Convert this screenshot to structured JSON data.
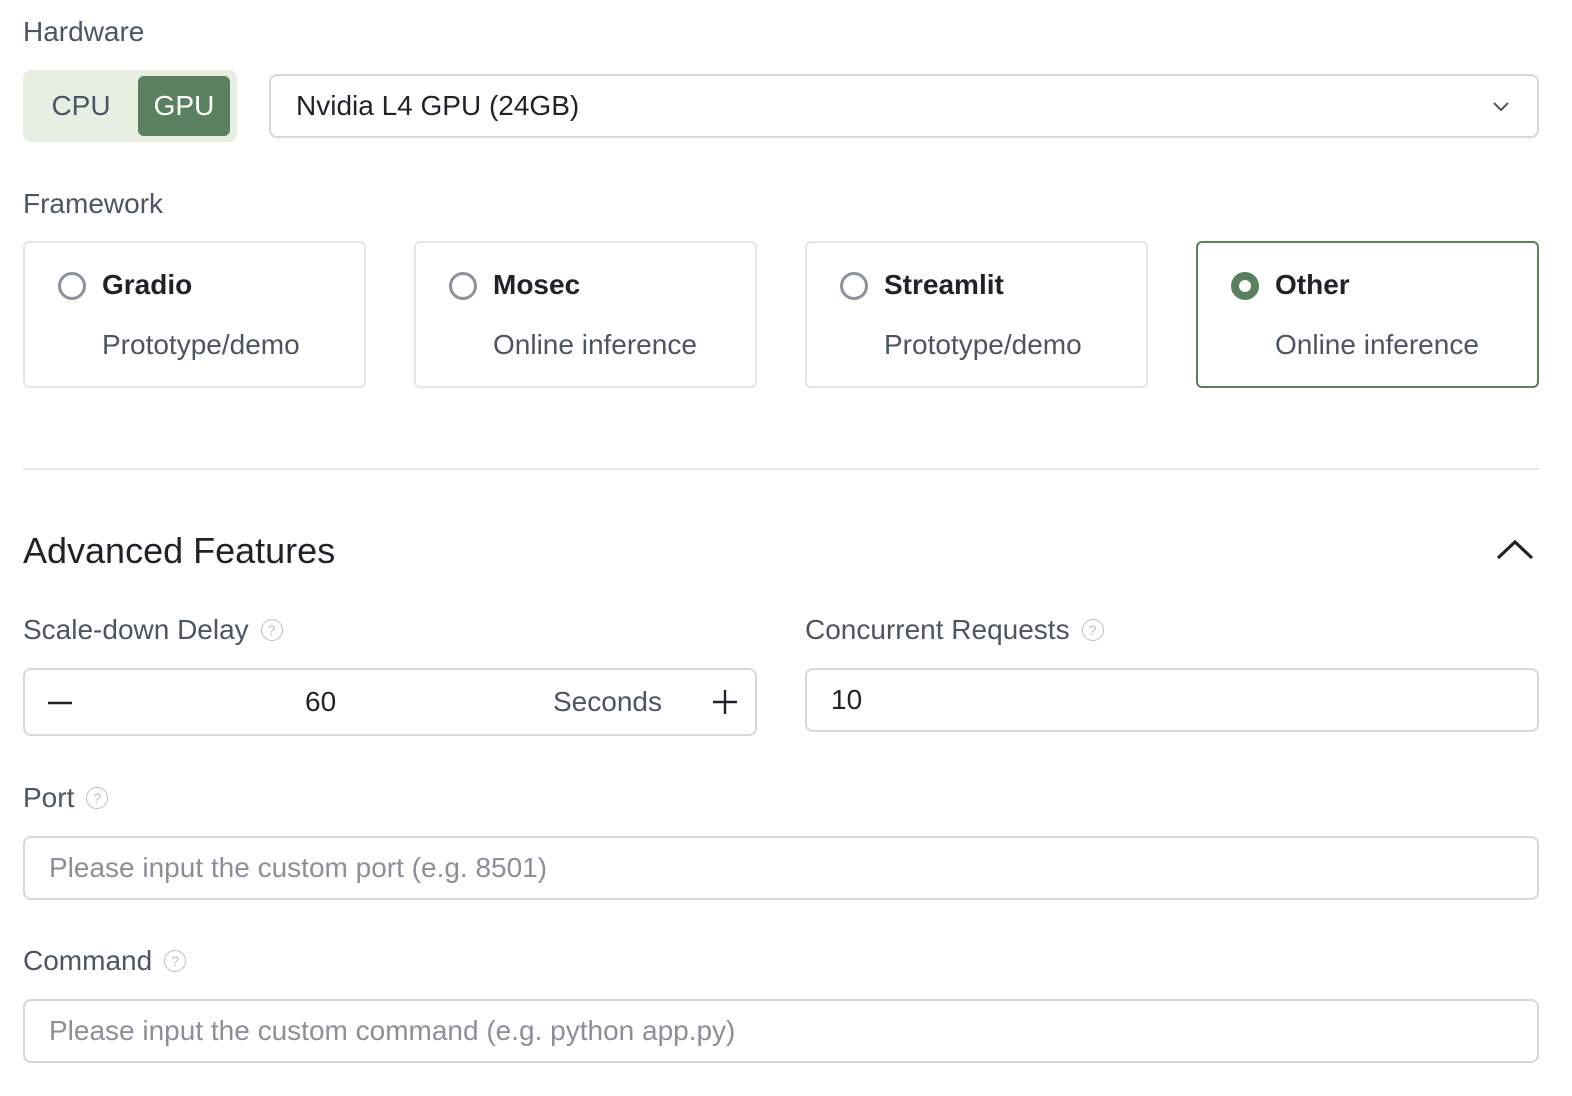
{
  "hardware": {
    "label": "Hardware",
    "options": [
      "CPU",
      "GPU"
    ],
    "selected": "GPU",
    "gpu_select": {
      "value": "Nvidia L4 GPU (24GB)"
    }
  },
  "framework": {
    "label": "Framework",
    "cards": [
      {
        "title": "Gradio",
        "subtitle": "Prototype/demo",
        "selected": false
      },
      {
        "title": "Mosec",
        "subtitle": "Online inference",
        "selected": false
      },
      {
        "title": "Streamlit",
        "subtitle": "Prototype/demo",
        "selected": false
      },
      {
        "title": "Other",
        "subtitle": "Online inference",
        "selected": true
      }
    ]
  },
  "advanced": {
    "title": "Advanced Features",
    "scale_down": {
      "label": "Scale-down Delay",
      "value": "60",
      "unit": "Seconds"
    },
    "concurrent": {
      "label": "Concurrent Requests",
      "value": "10"
    },
    "port": {
      "label": "Port",
      "placeholder": "Please input the custom port (e.g. 8501)"
    },
    "command": {
      "label": "Command",
      "placeholder": "Please input the custom command (e.g. python app.py)"
    }
  },
  "colors": {
    "accent": "#5a8060",
    "accent_light": "#e6efe2",
    "border": "#d4d8dd"
  }
}
